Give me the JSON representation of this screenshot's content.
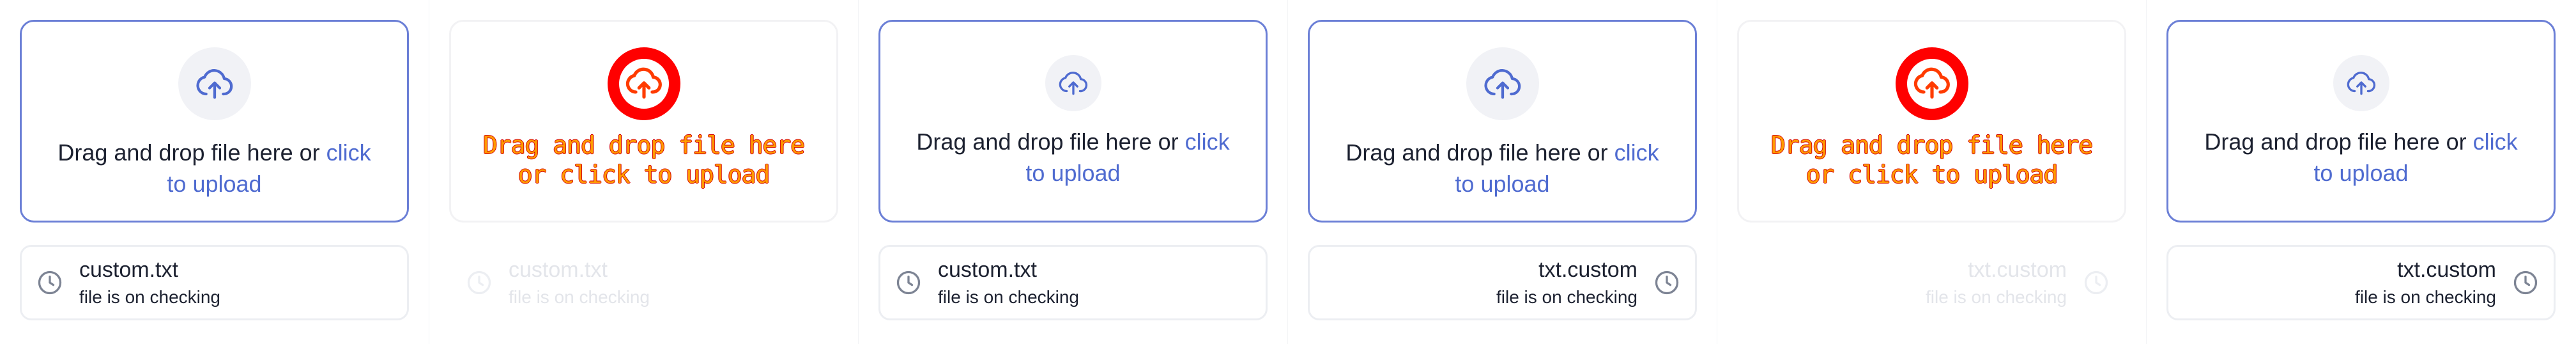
{
  "colors": {
    "accent": "#4f6bd0",
    "border": "#6b7fd6",
    "text": "#1c2130",
    "faded_text": "#e3e5ea",
    "broken_red": "#ff0000",
    "broken_orange": "#ff9a00"
  },
  "icons": {
    "upload": "cloud-upload-icon",
    "status": "clock-icon"
  },
  "panels": [
    {
      "dropzone": {
        "text": "Drag and drop file here or ",
        "link": "click to upload"
      },
      "file": {
        "name": "custom.txt",
        "status": "file is on checking"
      }
    },
    {
      "dropzone": {
        "text": "Drag and drop file here or click to upload"
      },
      "file": {
        "name": "custom.txt",
        "status": "file is on checking"
      }
    },
    {
      "dropzone": {
        "text": "Drag and drop file here or ",
        "link": "click to upload"
      },
      "file": {
        "name": "custom.txt",
        "status": "file is on checking"
      }
    },
    {
      "dropzone": {
        "text": "Drag and drop file here or ",
        "link": "click to upload"
      },
      "file": {
        "name": "txt.custom",
        "status": "file is on checking"
      }
    },
    {
      "dropzone": {
        "text": "Drag and drop file here or click to upload"
      },
      "file": {
        "name": "txt.custom",
        "status": "file is on checking"
      }
    },
    {
      "dropzone": {
        "text": "Drag and drop file here or ",
        "link": "click to upload"
      },
      "file": {
        "name": "txt.custom",
        "status": "file is on checking"
      }
    }
  ]
}
